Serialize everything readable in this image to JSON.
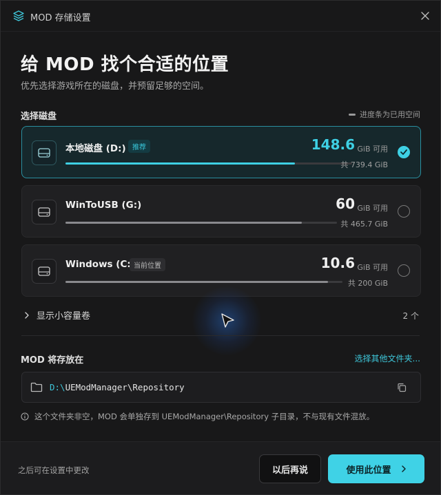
{
  "window": {
    "title": "MOD 存储设置"
  },
  "heading": "给 MOD 找个合适的位置",
  "subheading": "优先选择游戏所在的磁盘，并预留足够的空间。",
  "disk_section": {
    "label": "选择磁盘",
    "legend": "进度条为已用空间"
  },
  "disks": [
    {
      "name": "本地磁盘 (D:)",
      "badge": "推荐",
      "free": "148.6",
      "unit": "GiB 可用",
      "total": "共 739.4 GiB",
      "used_fraction": 0.8,
      "selected": true
    },
    {
      "name": "WinToUSB (G:)",
      "badge": "",
      "free": "60",
      "unit": "GiB 可用",
      "total": "共 465.7 GiB",
      "used_fraction": 0.87,
      "selected": false
    },
    {
      "name": "Windows (C:)",
      "badge": "当前位置",
      "free": "10.6",
      "unit": "GiB 可用",
      "total": "共 200 GiB",
      "used_fraction": 0.947,
      "selected": false
    }
  ],
  "small_volumes": {
    "label": "显示小容量卷",
    "count": "2 个"
  },
  "store": {
    "label": "MOD 将存放在",
    "choose_link": "选择其他文件夹...",
    "path_drive": "D:\\",
    "path_rest": "UEModManager\\Repository",
    "info": "这个文件夹非空，MOD 会单独存到 UEModManager\\Repository 子目录，不与现有文件混放。"
  },
  "footer": {
    "note": "之后可在设置中更改",
    "later_label": "以后再说",
    "use_label": "使用此位置"
  },
  "colors": {
    "accent": "#3ed0e4",
    "background": "#181819"
  }
}
